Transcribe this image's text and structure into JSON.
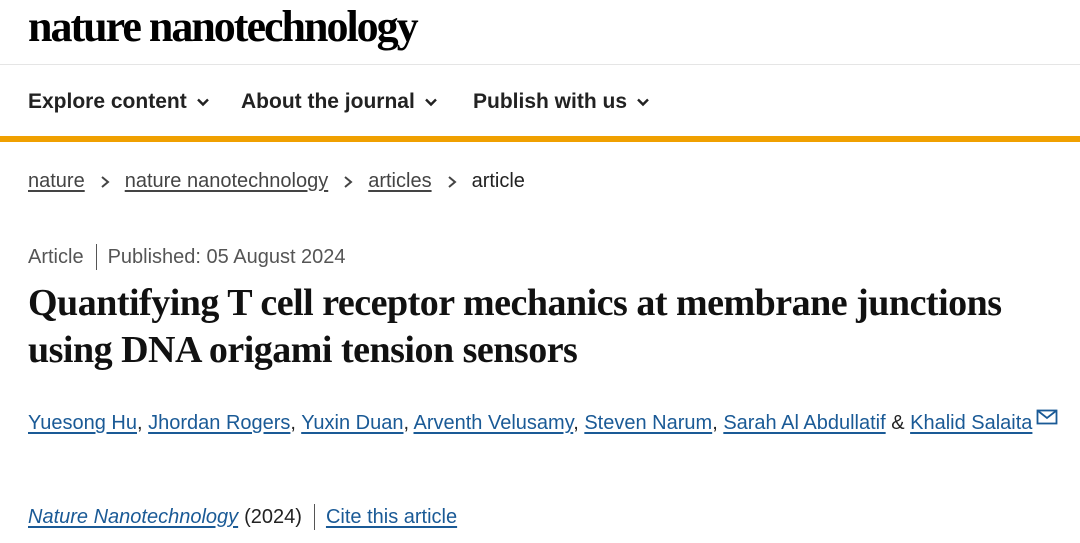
{
  "site": {
    "logo_text": "nature nanotechnology"
  },
  "nav": [
    {
      "label": "Explore content"
    },
    {
      "label": "About the journal"
    },
    {
      "label": "Publish with us"
    }
  ],
  "breadcrumb": [
    {
      "label": "nature"
    },
    {
      "label": "nature nanotechnology"
    },
    {
      "label": "articles"
    },
    {
      "label": "article"
    }
  ],
  "article": {
    "type": "Article",
    "published": "Published: 05 August 2024",
    "title": "Quantifying T cell receptor mechanics at membrane junctions using DNA origami tension sensors",
    "authors": [
      "Yuesong Hu",
      "Jhordan Rogers",
      "Yuxin Duan",
      "Arventh Velusamy",
      "Steven Narum",
      "Sarah Al Abdullatif",
      "Khalid Salaita"
    ],
    "author_separator": ", ",
    "last_author_joiner": " & ",
    "journal": "Nature Nanotechnology",
    "year": "(2024)",
    "cite_label": "Cite this article"
  },
  "colors": {
    "accent_bar": "#f0a000",
    "link": "#1a5a96"
  },
  "icons": {
    "dropdown": "chevron-down-icon",
    "breadcrumb_separator": "chevron-right-icon",
    "email": "envelope-icon"
  }
}
